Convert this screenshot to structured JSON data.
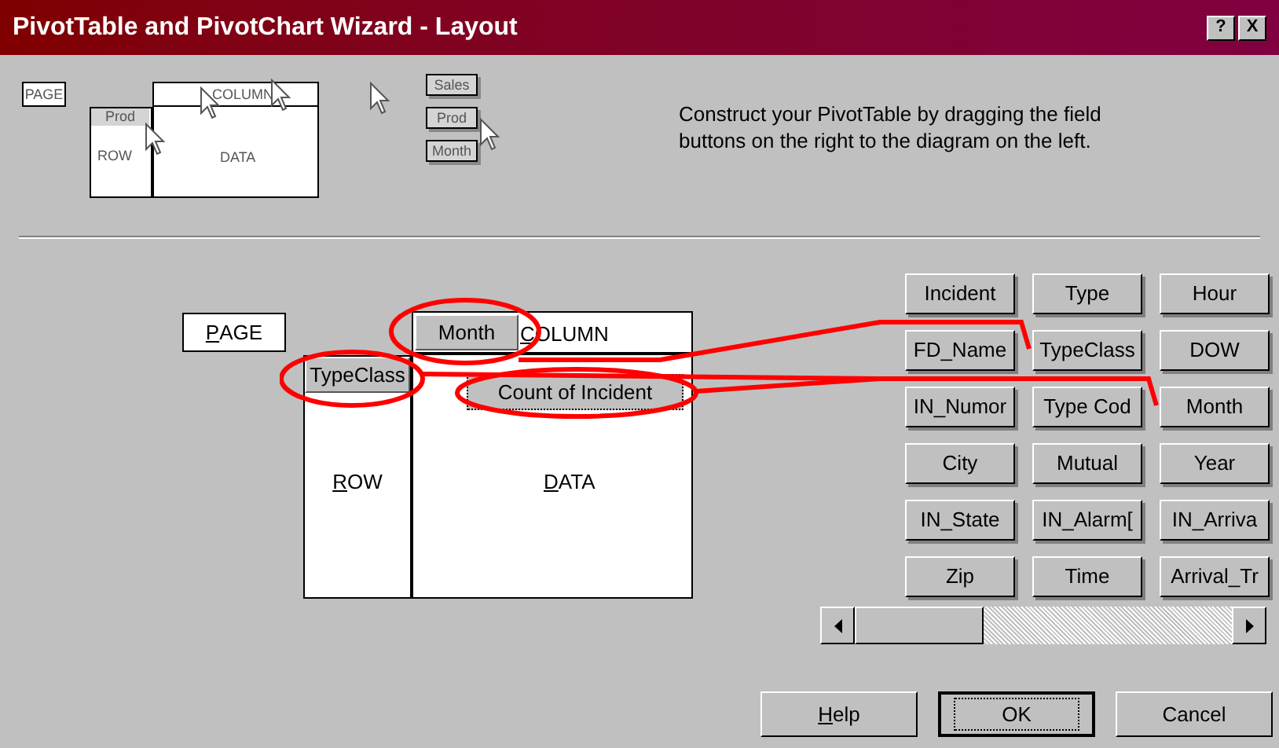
{
  "window": {
    "title": "PivotTable and PivotChart Wizard - Layout",
    "help_button": "?",
    "close_button": "X"
  },
  "illustration": {
    "page": "PAGE",
    "row_field": "Prod",
    "row": "ROW",
    "column": "COLUMN",
    "data": "DATA",
    "fields": [
      "Sales",
      "Prod",
      "Month"
    ]
  },
  "instructions": "Construct your PivotTable by dragging the field buttons on the right to the diagram on the left.",
  "layout": {
    "page_label": "PAGE",
    "column_label": "COLUMN",
    "row_label": "ROW",
    "data_label": "DATA",
    "column_field": "Month",
    "row_field": "TypeClass",
    "data_field": "Count of Incident"
  },
  "fields": [
    "Incident",
    "Type",
    "Hour",
    "FD_Name",
    "TypeClass",
    "DOW",
    "IN_Numor",
    "Type Cod",
    "Month",
    "City",
    "Mutual",
    "Year",
    "IN_State",
    "IN_Alarm[",
    "IN_Arriva",
    "Zip",
    "Time",
    "Arrival_Tr"
  ],
  "buttons": [
    {
      "label": "Help",
      "accelerator_underlined": true,
      "default": false
    },
    {
      "label": "OK",
      "accelerator_underlined": false,
      "default": true
    },
    {
      "label": "Cancel",
      "accelerator_underlined": false,
      "default": false
    }
  ]
}
